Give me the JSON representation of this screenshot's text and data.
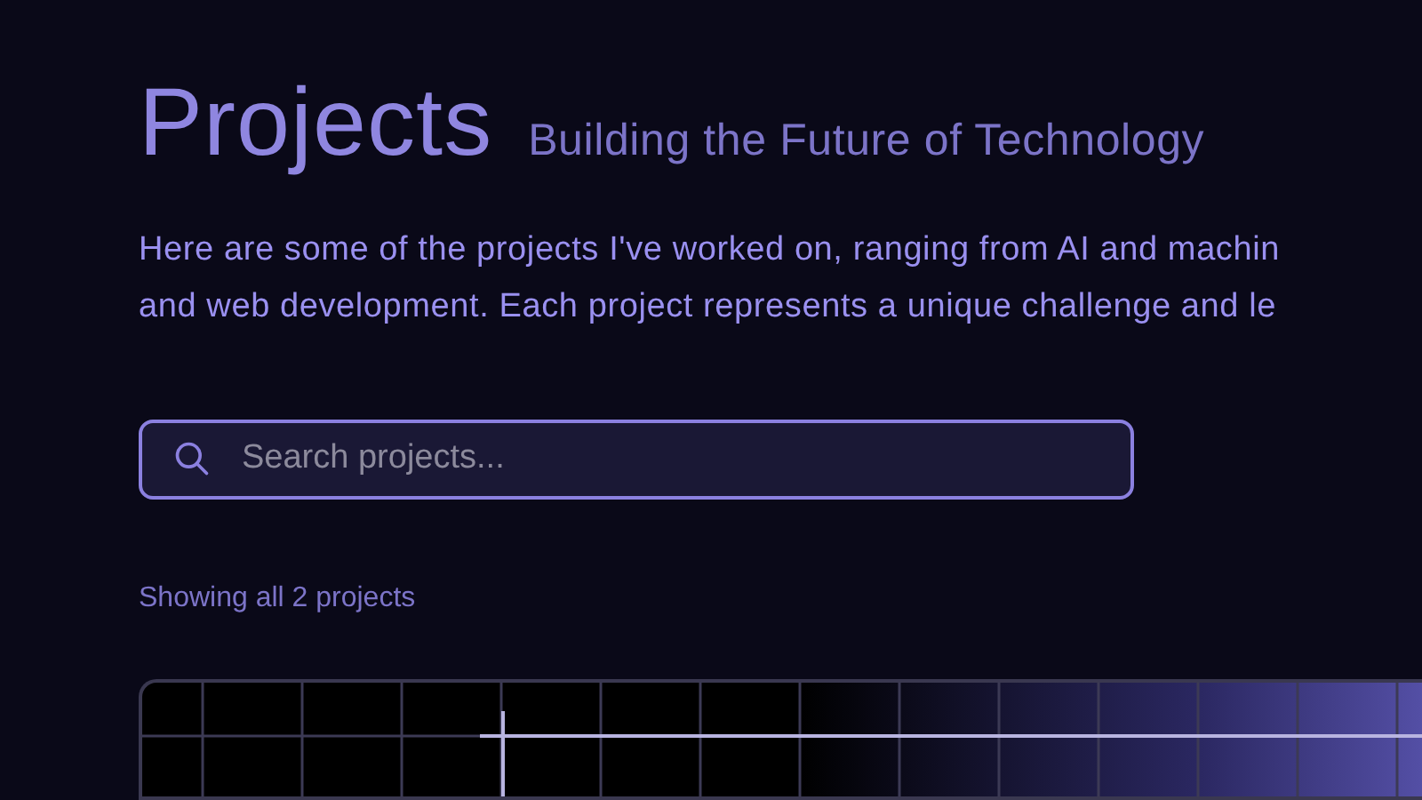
{
  "header": {
    "title": "Projects",
    "subtitle": "Building the Future of Technology"
  },
  "intro": [
    "Here are some of the projects I've worked on, ranging from AI and machin",
    "and web development. Each project represents a unique challenge and le"
  ],
  "search": {
    "placeholder": "Search projects..."
  },
  "result_count": "Showing all 2 projects"
}
